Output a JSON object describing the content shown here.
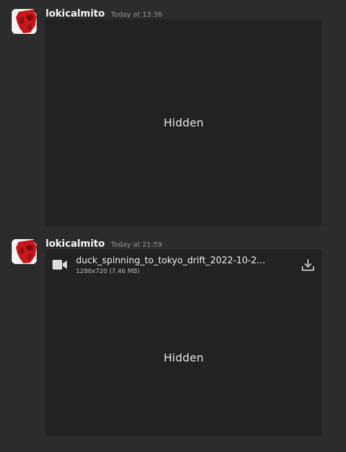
{
  "messages": [
    {
      "username": "lokicalmito",
      "timestamp": "Today at 13:36",
      "content": {
        "hidden_label": "Hidden"
      }
    },
    {
      "username": "lokicalmito",
      "timestamp": "Today at 21:59",
      "attachment": {
        "filename": "duck_spinning_to_tokyo_drift_2022-10-2...",
        "filesize": "1280x720 (7.46 MB)",
        "hidden_label": "Hidden"
      }
    }
  ],
  "icons": {
    "avatar": "red-mask-avatar",
    "video": "video-camera-icon",
    "download": "download-icon"
  },
  "colors": {
    "background": "#2c2c2c",
    "embed_background": "#222222",
    "username": "#f2f3f5",
    "timestamp": "#8f9297",
    "avatar_accent": "#c8171b"
  }
}
